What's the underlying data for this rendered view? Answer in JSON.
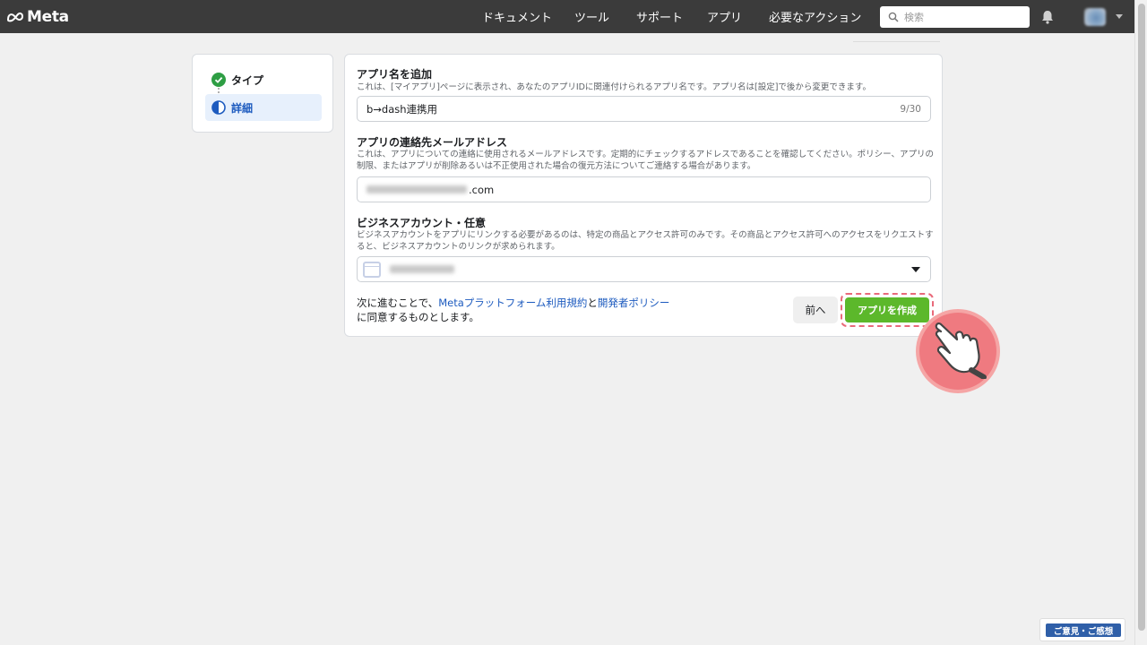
{
  "header": {
    "brand": "Meta",
    "nav": [
      "ドキュメント",
      "ツール",
      "サポート",
      "アプリ",
      "必要なアクション"
    ],
    "search_placeholder": "検索"
  },
  "steps": [
    {
      "label": "タイプ",
      "status": "complete"
    },
    {
      "label": "詳細",
      "status": "current"
    }
  ],
  "form": {
    "app_name": {
      "title": "アプリ名を追加",
      "description": "これは、[マイアプリ]ページに表示され、あなたのアプリIDに関連付けられるアプリ名です。アプリ名は[設定]で後から変更できます。",
      "value": "b→dash連携用",
      "counter": "9/30"
    },
    "contact_email": {
      "title": "アプリの連絡先メールアドレス",
      "description": "これは、アプリについての連絡に使用されるメールアドレスです。定期的にチェックするアドレスであることを確認してください。ポリシー、アプリの制限、またはアプリが削除あるいは不正使用された場合の復元方法についてご連絡する場合があります。",
      "value_suffix": ".com"
    },
    "business_account": {
      "title": "ビジネスアカウント・任意",
      "description": "ビジネスアカウントをアプリにリンクする必要があるのは、特定の商品とアクセス許可のみです。その商品とアクセス許可へのアクセスをリクエストすると、ビジネスアカウントのリンクが求められます。"
    }
  },
  "footer": {
    "agree_prefix": "次に進むことで、",
    "terms_link": "Metaプラットフォーム利用規約",
    "agree_and": "と",
    "policy_link": "開発者ポリシー",
    "agree_suffix": "に同意するものとします。",
    "prev_button": "前へ",
    "create_button": "アプリを作成"
  },
  "feedback_label": "ご意見・ご感想",
  "colors": {
    "topbar": "#3b3b3b",
    "link": "#1d5bbf",
    "create_button": "#5cb82b",
    "highlight": "#e96a7a"
  }
}
